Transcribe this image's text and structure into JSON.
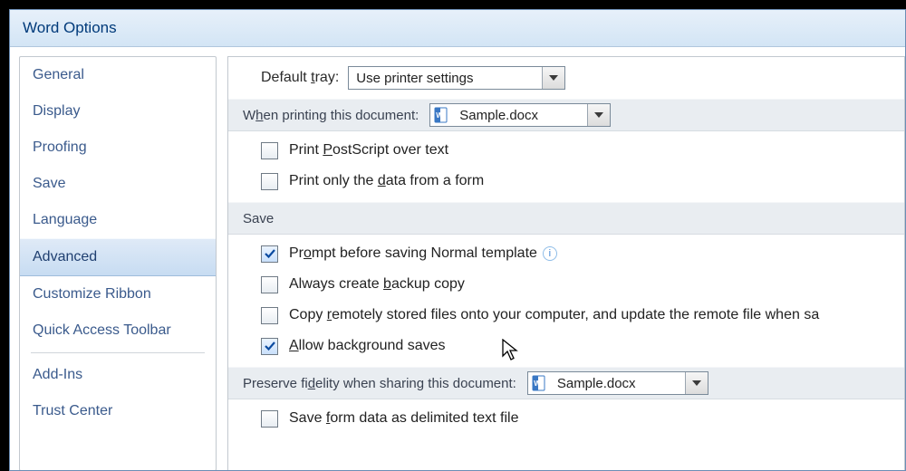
{
  "window": {
    "title": "Word Options"
  },
  "sidebar": {
    "items": [
      {
        "label": "General"
      },
      {
        "label": "Display"
      },
      {
        "label": "Proofing"
      },
      {
        "label": "Save"
      },
      {
        "label": "Language"
      },
      {
        "label": "Advanced",
        "selected": true
      },
      {
        "label": "Customize Ribbon"
      },
      {
        "label": "Quick Access Toolbar"
      },
      {
        "label": "Add-Ins"
      },
      {
        "label": "Trust Center"
      }
    ]
  },
  "main": {
    "default_tray": {
      "label": "Default tray:",
      "value": "Use printer settings"
    },
    "sections": {
      "when_printing": {
        "title": "When printing this document:",
        "doc": "Sample.docx"
      },
      "save": {
        "title": "Save"
      },
      "preserve_fidelity": {
        "title": "Preserve fidelity when sharing this document:",
        "doc": "Sample.docx"
      }
    },
    "checks": {
      "print_postscript": {
        "label": "Print PostScript over text",
        "checked": false
      },
      "print_only_data": {
        "label": "Print only the data from a form",
        "checked": false
      },
      "prompt_normal": {
        "label": "Prompt before saving Normal template",
        "checked": true
      },
      "always_backup": {
        "label": "Always create backup copy",
        "checked": false
      },
      "copy_remote": {
        "label": "Copy remotely stored files onto your computer, and update the remote file when sa",
        "checked": false
      },
      "allow_bg_saves": {
        "label": "Allow background saves",
        "checked": true
      },
      "save_form_data": {
        "label": "Save form data as delimited text file",
        "checked": false
      }
    }
  }
}
